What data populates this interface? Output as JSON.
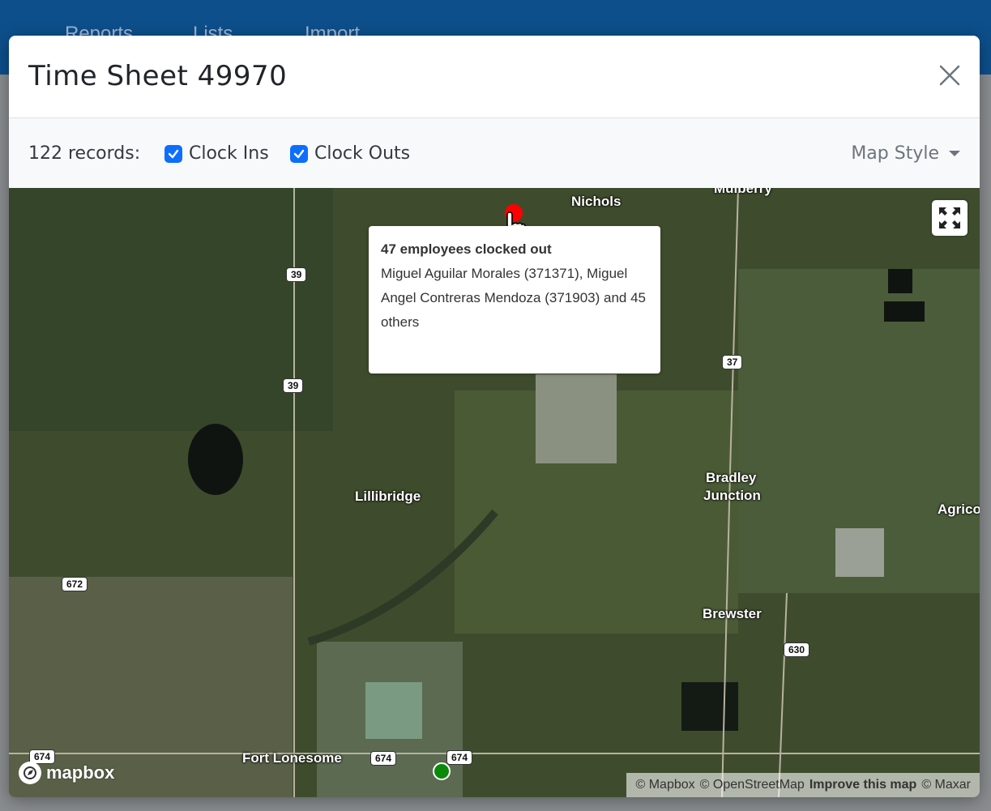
{
  "background": {
    "nav_items": [
      "Reports",
      "Lists",
      "Import"
    ]
  },
  "modal": {
    "title": "Time Sheet 49970",
    "close_icon": "close-icon"
  },
  "toolbar": {
    "records_label": "122 records:",
    "clock_ins_label": "Clock Ins",
    "clock_ins_checked": true,
    "clock_outs_label": "Clock Outs",
    "clock_outs_checked": true,
    "map_style_label": "Map Style"
  },
  "map": {
    "places": [
      "Nichols",
      "Mulberry",
      "Lillibridge",
      "Bradley Junction",
      "Agrico",
      "Brewster",
      "Fort Lonesome"
    ],
    "place_labels": {
      "nichols": "Nichols",
      "mulberry": "Mulberry",
      "lillibridge": "Lillibridge",
      "bradley1": "Bradley",
      "bradley2": "Junction",
      "agrico": "Agrico",
      "brewster": "Brewster",
      "fort_lonesome": "Fort Lonesome"
    },
    "road_shields": {
      "r39a": "39",
      "r39b": "39",
      "r37": "37",
      "r672": "672",
      "r630": "630",
      "r674a": "674",
      "r674b": "674",
      "r674c": "674"
    },
    "popup": {
      "title": "47 employees clocked out",
      "body": "Miguel Aguilar Morales (371371), Miguel Angel Contreras Mendoza (371903) and 45 others"
    },
    "logo_text": "mapbox",
    "attribution": {
      "mapbox": "© Mapbox",
      "osm": "© OpenStreetMap",
      "improve": "Improve this map",
      "maxar": "© Maxar"
    },
    "colors": {
      "clock_out_marker": "#ff0000",
      "clock_in_marker": "#0a8a0a"
    }
  }
}
